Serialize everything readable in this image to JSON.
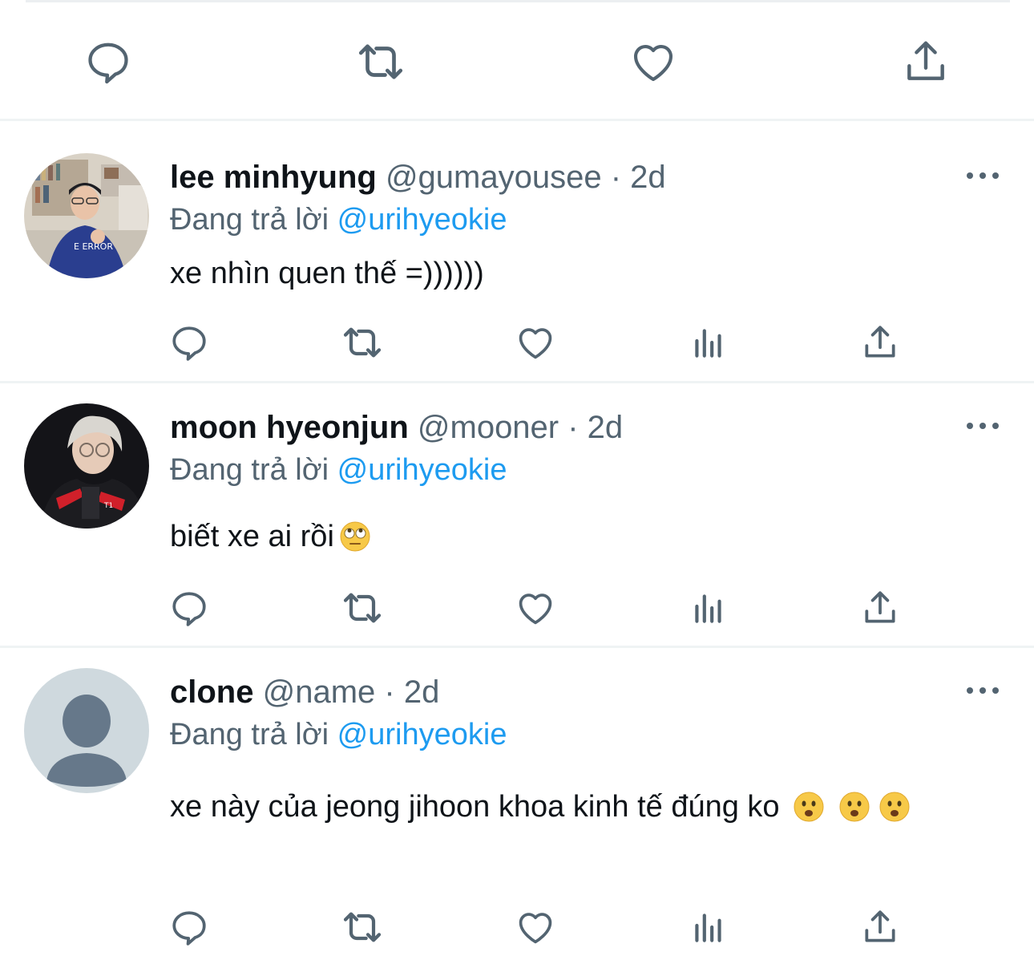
{
  "colors": {
    "accent": "#1d9bf0",
    "secondary": "#536471",
    "divider": "#eff3f4"
  },
  "top_actions": [
    "reply-icon",
    "retweet-icon",
    "like-icon",
    "share-icon"
  ],
  "replies": [
    {
      "name": "lee minhyung",
      "handle": "@gumayousee",
      "dot": " · ",
      "time": "2d",
      "replying_label": "Đang trả lời",
      "replying_to": "@urihyeokie",
      "text": "xe nhìn quen thế =))))))",
      "avatar": "photo-avatar"
    },
    {
      "name": "moon hyeonjun",
      "handle": "@mooner",
      "dot": " · ",
      "time": "2d",
      "replying_label": "Đang trả lời",
      "replying_to": "@urihyeokie",
      "text": "biết xe ai rồi",
      "emoji": "face-with-rolling-eyes",
      "avatar": "photo-avatar"
    },
    {
      "name": "clone",
      "handle": "@name",
      "dot": " · ",
      "time": "2d",
      "replying_label": "Đang trả lời",
      "replying_to": "@urihyeokie",
      "text": "xe này của jeong jihoon khoa kinh tế đúng ko",
      "emoji": "frowning-face-with-open-mouth",
      "avatar": "default-avatar"
    }
  ]
}
